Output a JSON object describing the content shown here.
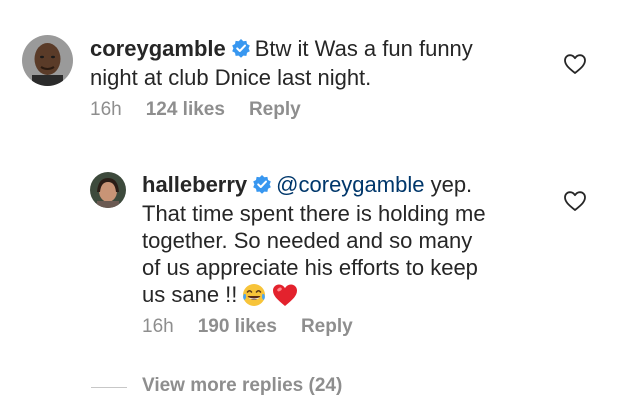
{
  "comments": [
    {
      "username": "coreygamble",
      "verified": true,
      "line1": "Btw it Was a fun funny",
      "line2": "night at club Dnice last night.",
      "time": "16h",
      "likes": "124 likes",
      "reply_label": "Reply"
    },
    {
      "username": "halleberry",
      "verified": true,
      "mention": "@coreygamble",
      "line1_rest": " yep.",
      "line2": "That time spent there is holding me",
      "line3": "together.  So needed and so many",
      "line4": "of us appreciate his efforts to keep",
      "line5": "us sane !!",
      "emojis": [
        "tears-of-joy-emoji",
        "red-heart-emoji"
      ],
      "time": "16h",
      "likes": "190 likes",
      "reply_label": "Reply"
    }
  ],
  "view_more": "View more replies (24)",
  "colors": {
    "text": "#262626",
    "meta": "#8e8e8e",
    "mention": "#00376b",
    "verified": "#3897f0"
  }
}
